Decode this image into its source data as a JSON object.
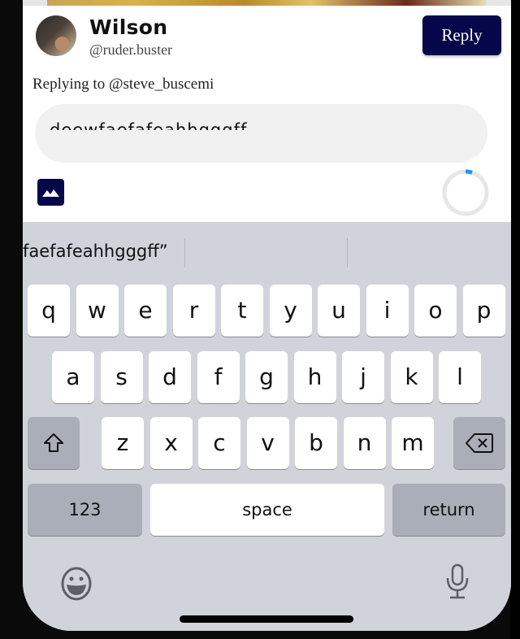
{
  "composer": {
    "user": {
      "display_name": "Wilson",
      "handle": "@ruder.buster"
    },
    "reply_button_label": "Reply",
    "replying_to": "Replying to @steve_buscemi",
    "input_value": "deewfaefafeahhgggff",
    "image_button_icon": "image-icon",
    "character_progress": 0.05,
    "colors": {
      "brand": "#06074a",
      "progress": "#2196f3",
      "progress_track": "#e6e6e6"
    }
  },
  "keyboard": {
    "suggestion": "faefafeahhgggff”",
    "row1": [
      "q",
      "w",
      "e",
      "r",
      "t",
      "y",
      "u",
      "i",
      "o",
      "p"
    ],
    "row2": [
      "a",
      "s",
      "d",
      "f",
      "g",
      "h",
      "j",
      "k",
      "l"
    ],
    "row3": [
      "z",
      "x",
      "c",
      "v",
      "b",
      "n",
      "m"
    ],
    "numbers_label": "123",
    "space_label": "space",
    "return_label": "return",
    "shift_icon": "shift-icon",
    "delete_icon": "delete-icon",
    "emoji_icon": "emoji-icon",
    "mic_icon": "microphone-icon"
  }
}
